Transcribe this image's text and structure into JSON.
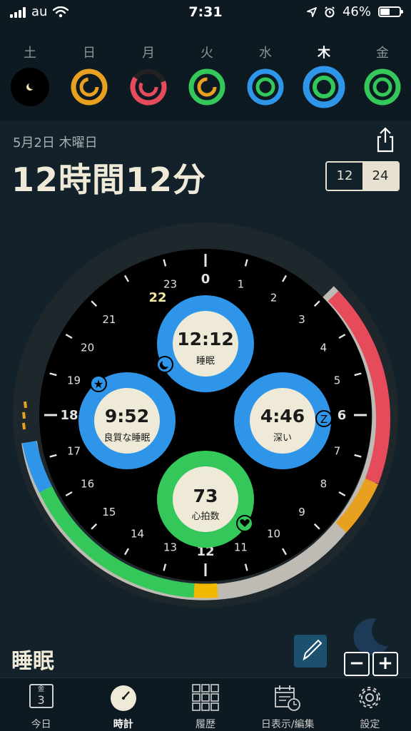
{
  "status_bar": {
    "carrier": "au",
    "time": "7:31",
    "battery": "46%"
  },
  "week": [
    {
      "label": "土",
      "ring": "moon"
    },
    {
      "label": "日",
      "ring": "orange"
    },
    {
      "label": "月",
      "ring": "red"
    },
    {
      "label": "火",
      "ring": "green-orange"
    },
    {
      "label": "水",
      "ring": "blue-green"
    },
    {
      "label": "木",
      "ring": "blue-green-active",
      "active": true
    },
    {
      "label": "金",
      "ring": "green"
    }
  ],
  "header": {
    "date": "5月2日 木曜日",
    "duration": "12時間12分",
    "format_12": "12",
    "format_24": "24"
  },
  "clock": {
    "hour_labels": [
      "0",
      "1",
      "2",
      "3",
      "4",
      "5",
      "6",
      "7",
      "8",
      "9",
      "10",
      "11",
      "12",
      "13",
      "14",
      "15",
      "16",
      "17",
      "18",
      "19",
      "20",
      "21",
      "22",
      "23"
    ],
    "current_hour_label": "22",
    "stats": [
      {
        "id": "sleep",
        "value": "12:12",
        "label": "睡眠",
        "icon": "moon-icon"
      },
      {
        "id": "quality",
        "value": "9:52",
        "label": "良質な睡眠",
        "icon": "star-icon"
      },
      {
        "id": "deep",
        "value": "4:46",
        "label": "深い",
        "icon": "z-icon"
      },
      {
        "id": "heart",
        "value": "73",
        "label": "心拍数",
        "icon": "heart-icon"
      }
    ]
  },
  "footer": {
    "mode_title": "睡眠"
  },
  "tabs": [
    {
      "label": "今日",
      "icon": "calendar-icon",
      "cal_day": "金",
      "cal_num": "3"
    },
    {
      "label": "時計",
      "icon": "clock-icon",
      "active": true
    },
    {
      "label": "履歴",
      "icon": "grid-icon"
    },
    {
      "label": "日表示/編集",
      "icon": "calendar-edit-icon"
    },
    {
      "label": "設定",
      "icon": "gear-icon"
    }
  ],
  "colors": {
    "blue": "#2e95e8",
    "green": "#34c85a",
    "red": "#e54b5a",
    "orange": "#e8a020",
    "cream": "#efe9d8",
    "background": "#0d1a22"
  }
}
